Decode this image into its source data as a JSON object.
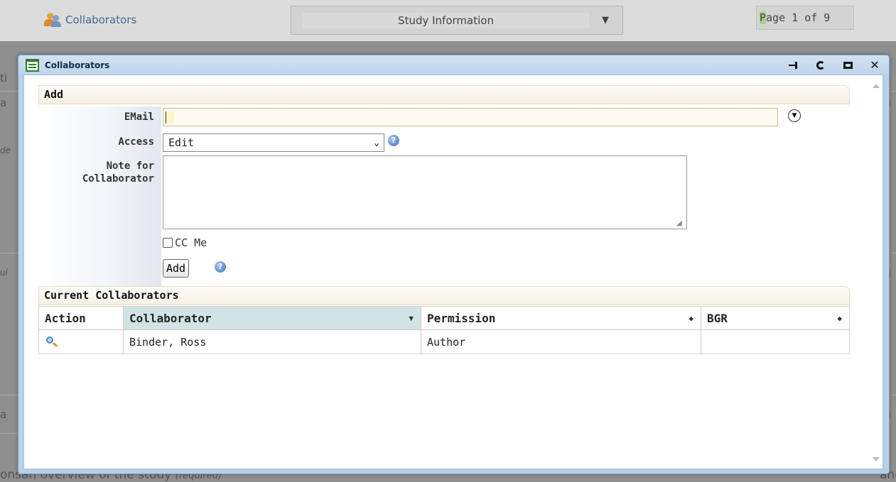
{
  "background": {
    "collaborators_link": "Collaborators",
    "section_select": "Study Information",
    "page_indicator_prefix": "P",
    "page_indicator_rest": "age 1 of 9",
    "bottom_text": "onsan overview of the study",
    "bottom_text_note": "(required)",
    "bottom_text_right": "and"
  },
  "dialog": {
    "title": "Collaborators",
    "tools": [
      "pin",
      "refresh",
      "maximize",
      "close"
    ],
    "add_section": {
      "header": "Add",
      "email_label": "EMail",
      "email_value": "",
      "access_label": "Access",
      "access_value": "Edit",
      "note_label_line1": "Note for",
      "note_label_line2": "Collaborator",
      "note_value": "",
      "cc_label": "CC Me",
      "cc_checked": false,
      "add_button": "Add"
    },
    "current_section": {
      "header": "Current Collaborators",
      "columns": [
        "Action",
        "Collaborator",
        "Permission",
        "BGR"
      ],
      "rows": [
        {
          "collaborator": "Binder, Ross",
          "permission": "Author",
          "bgr": ""
        }
      ]
    }
  },
  "colors": {
    "dialog_border": "#7ea3c9",
    "section_header_bg": "#f6efe2",
    "sorted_column_bg": "#d2e3e6",
    "email_field_border": "#d2b98b"
  }
}
